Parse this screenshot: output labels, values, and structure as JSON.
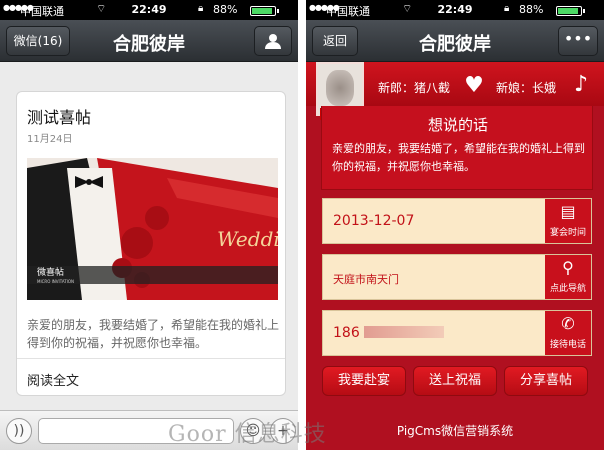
{
  "status": {
    "carrier": "中国联通",
    "time": "22:49",
    "battery": "88%"
  },
  "left": {
    "nav": {
      "back_label": "微信(16)",
      "title": "合肥彼岸"
    },
    "card": {
      "title": "测试喜帖",
      "date": "11月24日",
      "image_caption": "微喜帖",
      "image_sub": "MICRO INVITATION",
      "image_script": "Wedding",
      "description": "亲爱的朋友，我要结婚了，希望能在我的婚礼上得到你的祝福，并祝愿你也幸福。",
      "read_more": "阅读全文"
    }
  },
  "right": {
    "nav": {
      "back_label": "返回",
      "title": "合肥彼岸",
      "more": "•••"
    },
    "groom_label": "新郎：猪八截",
    "bride_label": "新娘：长娥",
    "words_title": "想说的话",
    "words_text": "亲爱的朋友，我要结婚了，希望能在我的婚礼上得到你的祝福，并祝愿你也幸福。",
    "date": "2013-12-07",
    "date_tile": "宴会时间",
    "address": "天庭市南天门",
    "address_tile": "点此导航",
    "phone_prefix": "186",
    "phone_tile": "接待电话",
    "buttons": [
      "我要赴宴",
      "送上祝福",
      "分享喜帖"
    ],
    "footer": "PigCms微信营销系统"
  },
  "watermark": "Goor   信息科技",
  "colors": {
    "accent_red": "#c8101c",
    "row_bg": "#fbe9c8",
    "nav_dark": "#2b2f33"
  }
}
